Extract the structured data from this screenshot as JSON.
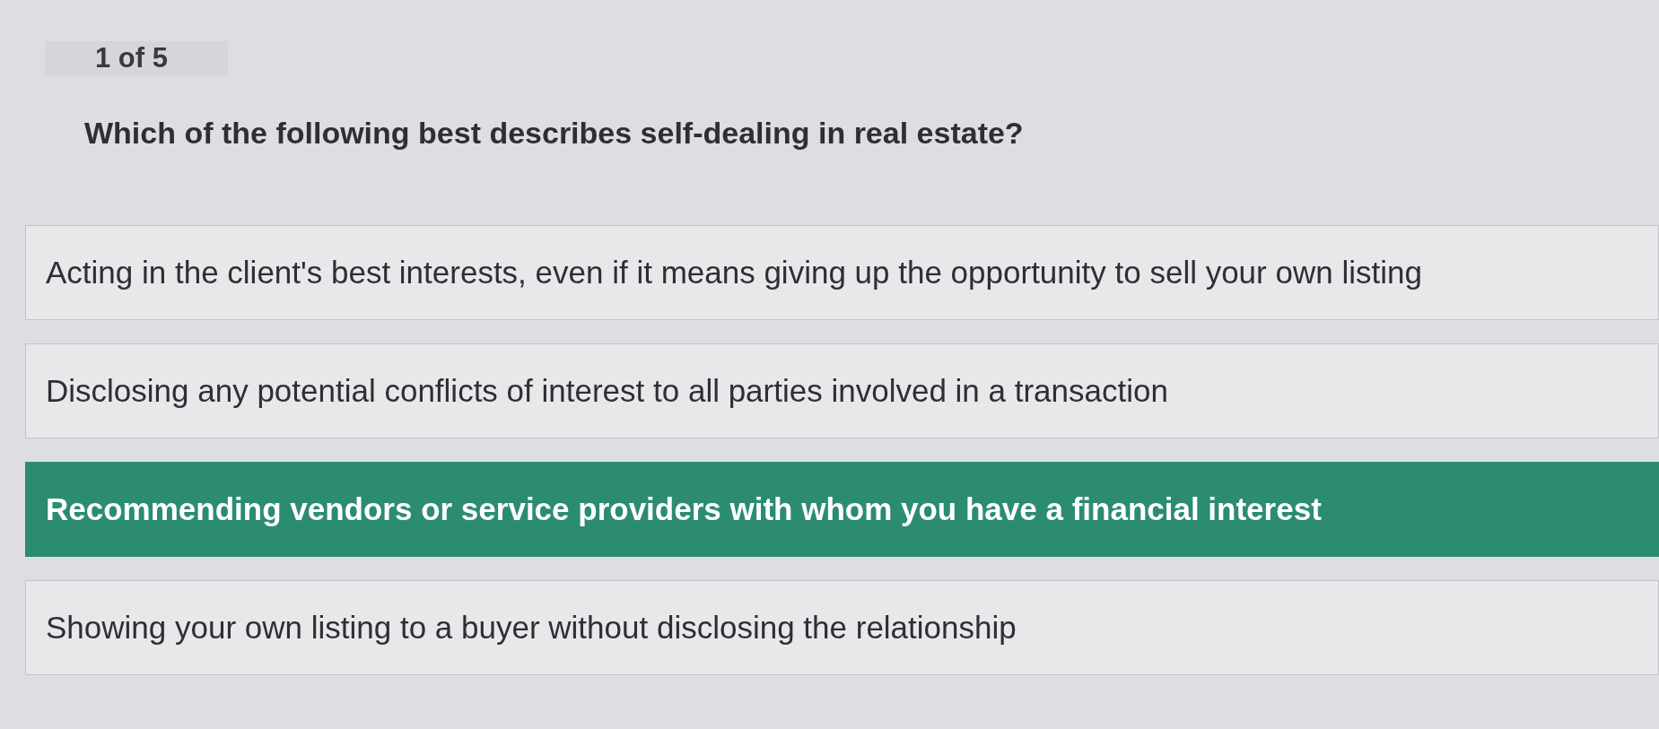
{
  "progress": "1 of 5",
  "question": "Which of the following best describes self-dealing in real estate?",
  "options": [
    {
      "label": "Acting in the client's best interests, even if it means giving up the opportunity to sell your own listing",
      "selected": false
    },
    {
      "label": "Disclosing any potential conflicts of interest to all parties involved in a transaction",
      "selected": false
    },
    {
      "label": "Recommending vendors or service providers with whom you have a financial interest",
      "selected": true
    },
    {
      "label": "Showing your own listing to a buyer without disclosing the relationship",
      "selected": false
    }
  ]
}
